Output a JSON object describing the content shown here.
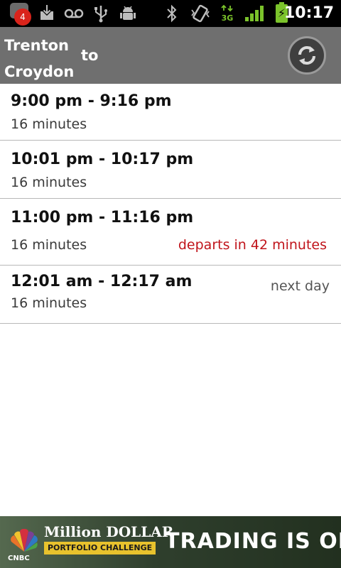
{
  "status_bar": {
    "notification_count": "4",
    "time": "10:17",
    "network_label": "3G",
    "icons": [
      "notification-app-icon",
      "download-icon",
      "voicemail-icon",
      "usb-icon",
      "android-debug-icon",
      "bluetooth-icon",
      "vibrate-icon",
      "data-3g-icon",
      "signal-icon",
      "battery-charging-icon"
    ]
  },
  "header": {
    "origin": "Trenton",
    "destination": "Croydon",
    "connector": "to",
    "refresh_icon": "refresh-icon"
  },
  "trips": [
    {
      "times": "9:00 pm - 9:16 pm",
      "duration": "16 minutes",
      "note": ""
    },
    {
      "times": "10:01 pm - 10:17 pm",
      "duration": "16 minutes",
      "note": ""
    },
    {
      "times": "11:00 pm - 11:16 pm",
      "duration": "16 minutes",
      "note": "departs in 42 minutes"
    },
    {
      "times": "12:01 am - 12:17 am",
      "duration": "16 minutes",
      "note": "next day"
    }
  ],
  "ad": {
    "brand": "CNBC",
    "title": "Million DOLLAR",
    "subtitle": "PORTFOLIO CHALLENGE",
    "tagline": "TRADING IS ON"
  },
  "colors": {
    "titlebar": "#6f6f6f",
    "departs_text": "#c0141b",
    "status_green": "#7bc32b"
  }
}
